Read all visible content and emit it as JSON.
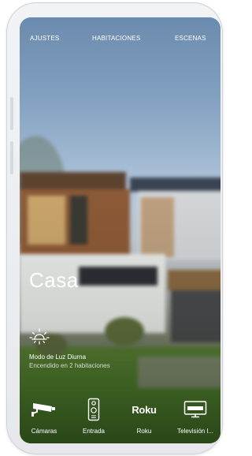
{
  "nav": {
    "settings": "AJUSTES",
    "rooms": "HABITACIONES",
    "scenes": "ESCENAS"
  },
  "home": {
    "title": "Casa"
  },
  "scene": {
    "icon": "sun-icon",
    "title": "Modo de Luz Diurna",
    "subtitle": "Encendido en 2 habitaciones"
  },
  "devices": [
    {
      "icon": "security-camera-icon",
      "label": "Cámaras"
    },
    {
      "icon": "doorbell-icon",
      "label": "Entrada"
    },
    {
      "icon": "roku-logo",
      "logo_text": "Roku",
      "label": "Roku"
    },
    {
      "icon": "tv-icon",
      "label": "Televisión l..."
    }
  ],
  "colors": {
    "text": "#ffffff",
    "subtext": "#d5dcd1",
    "phone_frame": "#eceef1"
  }
}
